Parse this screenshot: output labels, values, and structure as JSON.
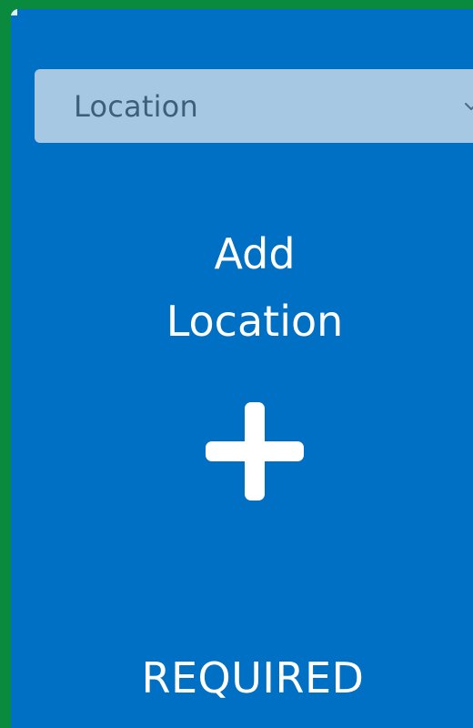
{
  "location_select": {
    "value": "Location",
    "icon": "chevron-down-icon"
  },
  "add_location": {
    "line1": "Add",
    "line2": "Location",
    "icon": "plus-icon"
  },
  "status": {
    "label": "REQUIRED"
  },
  "colors": {
    "frame": "#0a8a3c",
    "card": "#0070c4",
    "select_bg": "#a6c8e3",
    "select_text": "#3e5f78",
    "text": "#ffffff"
  }
}
